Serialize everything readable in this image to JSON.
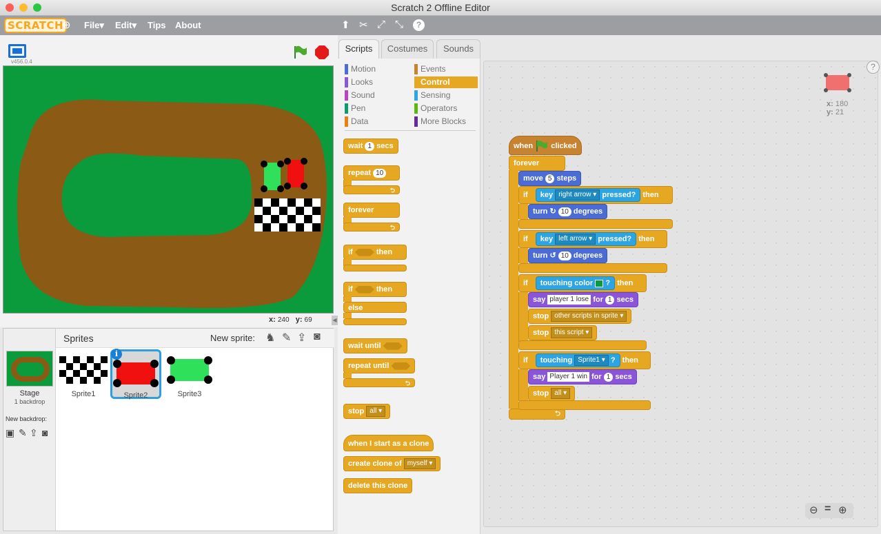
{
  "window": {
    "title": "Scratch 2 Offline Editor"
  },
  "menubar": {
    "logo": "SCRATCH",
    "file": "File",
    "edit": "Edit",
    "tips": "Tips",
    "about": "About",
    "caret": "▾"
  },
  "stage": {
    "version": "v456.0.4",
    "x_label": "x:",
    "x_value": "240",
    "y_label": "y:",
    "y_value": "69"
  },
  "sprites": {
    "header": "Sprites",
    "new_sprite_label": "New sprite:",
    "stage_label": "Stage",
    "backdrop_count": "1 backdrop",
    "new_backdrop_label": "New backdrop:",
    "items": [
      {
        "name": "Sprite1"
      },
      {
        "name": "Sprite2",
        "selected": true
      },
      {
        "name": "Sprite3"
      }
    ]
  },
  "tabs": [
    "Scripts",
    "Costumes",
    "Sounds"
  ],
  "categories": {
    "left": [
      {
        "label": "Motion",
        "color": "#4a6cd4"
      },
      {
        "label": "Looks",
        "color": "#8a55d7"
      },
      {
        "label": "Sound",
        "color": "#bb42c3"
      },
      {
        "label": "Pen",
        "color": "#0e9a6c"
      },
      {
        "label": "Data",
        "color": "#ee7d16"
      }
    ],
    "right": [
      {
        "label": "Events",
        "color": "#c88330"
      },
      {
        "label": "Control",
        "color": "#e6a822"
      },
      {
        "label": "Sensing",
        "color": "#2ca5e2"
      },
      {
        "label": "Operators",
        "color": "#5cb712"
      },
      {
        "label": "More Blocks",
        "color": "#632d99"
      }
    ]
  },
  "palette": {
    "wait": "wait",
    "wait_num": "1",
    "secs": "secs",
    "repeat": "repeat",
    "repeat_num": "10",
    "forever": "forever",
    "if": "if",
    "then": "then",
    "else": "else",
    "wait_until": "wait until",
    "repeat_until": "repeat until",
    "stop": "stop",
    "stop_opt": "all",
    "clone_hat": "when I start as a clone",
    "create_clone": "create clone of",
    "clone_opt": "myself",
    "delete_clone": "delete this clone"
  },
  "script": {
    "when": "when",
    "clicked": "clicked",
    "forever": "forever",
    "move": "move",
    "move_num": "5",
    "steps": "steps",
    "if": "if",
    "then": "then",
    "key": "key",
    "pressed": "pressed?",
    "right_arrow": "right arrow",
    "left_arrow": "left arrow",
    "turn": "turn",
    "turn_num": "10",
    "degrees": "degrees",
    "touching_color": "touching color",
    "q": "?",
    "say": "say",
    "lose_text": "player 1 lose",
    "win_text": "Player 1 win",
    "for": "for",
    "secs_num": "1",
    "secs": "secs",
    "stop": "stop",
    "other_scripts": "other scripts in sprite",
    "this_script": "this script",
    "all": "all",
    "touching": "touching",
    "sprite1": "Sprite1"
  },
  "sprite_info": {
    "x_label": "x:",
    "x_value": "180",
    "y_label": "y:",
    "y_value": "21"
  }
}
